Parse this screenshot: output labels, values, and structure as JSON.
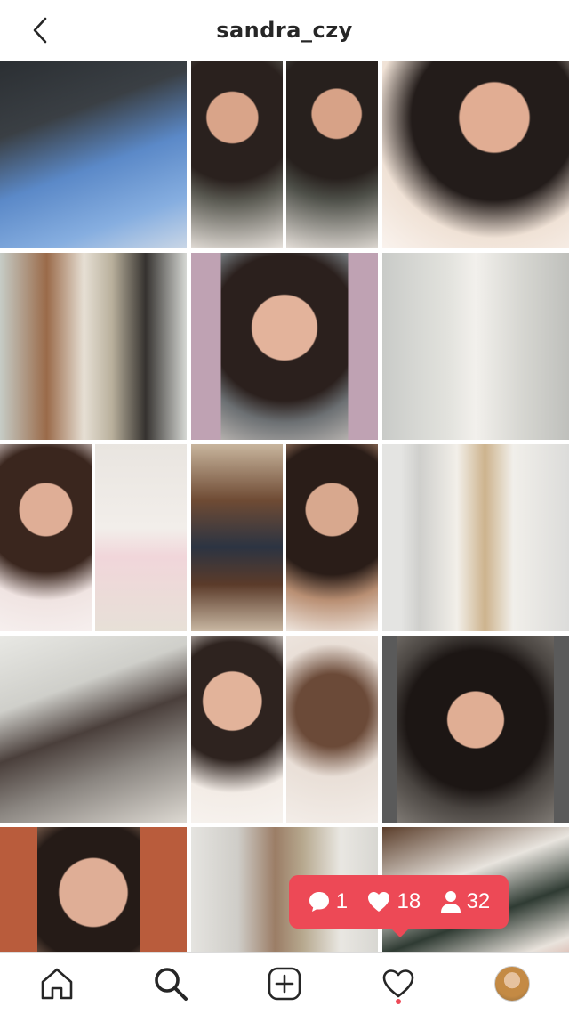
{
  "header": {
    "back_icon": "chevron-left-icon",
    "title": "sandra_czy"
  },
  "grid": {
    "posts": [
      {
        "layout": "single",
        "desc": "photo"
      },
      {
        "layout": "split",
        "desc": "photo"
      },
      {
        "layout": "single",
        "desc": "photo"
      },
      {
        "layout": "single",
        "desc": "photo"
      },
      {
        "layout": "single",
        "desc": "photo"
      },
      {
        "layout": "single",
        "desc": "photo"
      },
      {
        "layout": "split",
        "desc": "photo"
      },
      {
        "layout": "split",
        "desc": "photo"
      },
      {
        "layout": "single",
        "desc": "photo"
      },
      {
        "layout": "single",
        "desc": "photo"
      },
      {
        "layout": "split",
        "desc": "photo"
      },
      {
        "layout": "single",
        "desc": "photo"
      },
      {
        "layout": "single",
        "desc": "photo"
      },
      {
        "layout": "single",
        "desc": "photo"
      },
      {
        "layout": "single",
        "desc": "photo"
      }
    ]
  },
  "notification": {
    "comments": "1",
    "likes": "18",
    "followers": "32",
    "color": "#ed4956"
  },
  "tabbar": {
    "items": [
      "home-icon",
      "search-icon",
      "add-post-icon",
      "activity-heart-icon",
      "profile-avatar"
    ],
    "activity_dot_color": "#ed4956"
  }
}
